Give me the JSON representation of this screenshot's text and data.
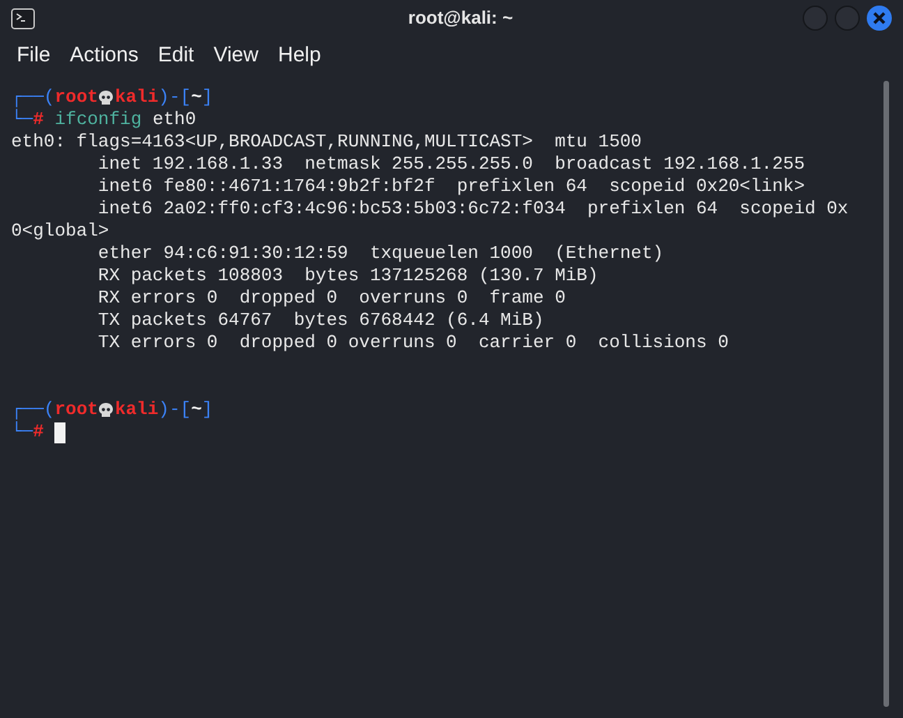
{
  "window": {
    "title": "root@kali: ~"
  },
  "menu": [
    "File",
    "Actions",
    "Edit",
    "View",
    "Help"
  ],
  "terminal": [
    {
      "kind": "prompt",
      "open": "┌──(",
      "user": "root",
      "host": "kali",
      "mid": ")-[",
      "dir": "~",
      "close": "]",
      "corner": "└─",
      "sign": "#",
      "command": "ifconfig",
      "args": "eth0",
      "cursor": false
    },
    {
      "kind": "output",
      "lines": [
        "eth0: flags=4163<UP,BROADCAST,RUNNING,MULTICAST>  mtu 1500",
        "        inet 192.168.1.33  netmask 255.255.255.0  broadcast 192.168.1.255",
        "        inet6 fe80::4671:1764:9b2f:bf2f  prefixlen 64  scopeid 0x20<link>",
        "        inet6 2a02:ff0:cf3:4c96:bc53:5b03:6c72:f034  prefixlen 64  scopeid 0x",
        "0<global>",
        "        ether 94:c6:91:30:12:59  txqueuelen 1000  (Ethernet)",
        "        RX packets 108803  bytes 137125268 (130.7 MiB)",
        "        RX errors 0  dropped 0  overruns 0  frame 0",
        "        TX packets 64767  bytes 6768442 (6.4 MiB)",
        "        TX errors 0  dropped 0 overruns 0  carrier 0  collisions 0"
      ]
    },
    {
      "kind": "prompt",
      "open": "┌──(",
      "user": "root",
      "host": "kali",
      "mid": ")-[",
      "dir": "~",
      "close": "]",
      "corner": "└─",
      "sign": "#",
      "cursor": true
    }
  ]
}
